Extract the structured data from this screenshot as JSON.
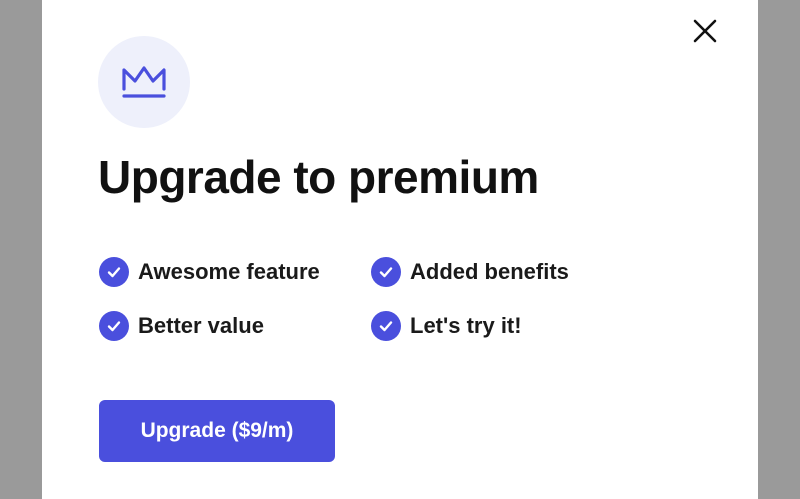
{
  "modal": {
    "title": "Upgrade to premium",
    "badge_icon": "crown-icon",
    "close_icon": "close-icon",
    "features": [
      {
        "label": "Awesome feature",
        "icon": "check-circle-icon"
      },
      {
        "label": "Added benefits",
        "icon": "check-circle-icon"
      },
      {
        "label": "Better value",
        "icon": "check-circle-icon"
      },
      {
        "label": "Let's try it!",
        "icon": "check-circle-icon"
      }
    ],
    "cta_label": "Upgrade ($9/m)"
  },
  "colors": {
    "accent": "#4a4fdd",
    "badge_bg": "#eef0fb",
    "backdrop": "#9a9a9a",
    "title_text": "#111111"
  }
}
